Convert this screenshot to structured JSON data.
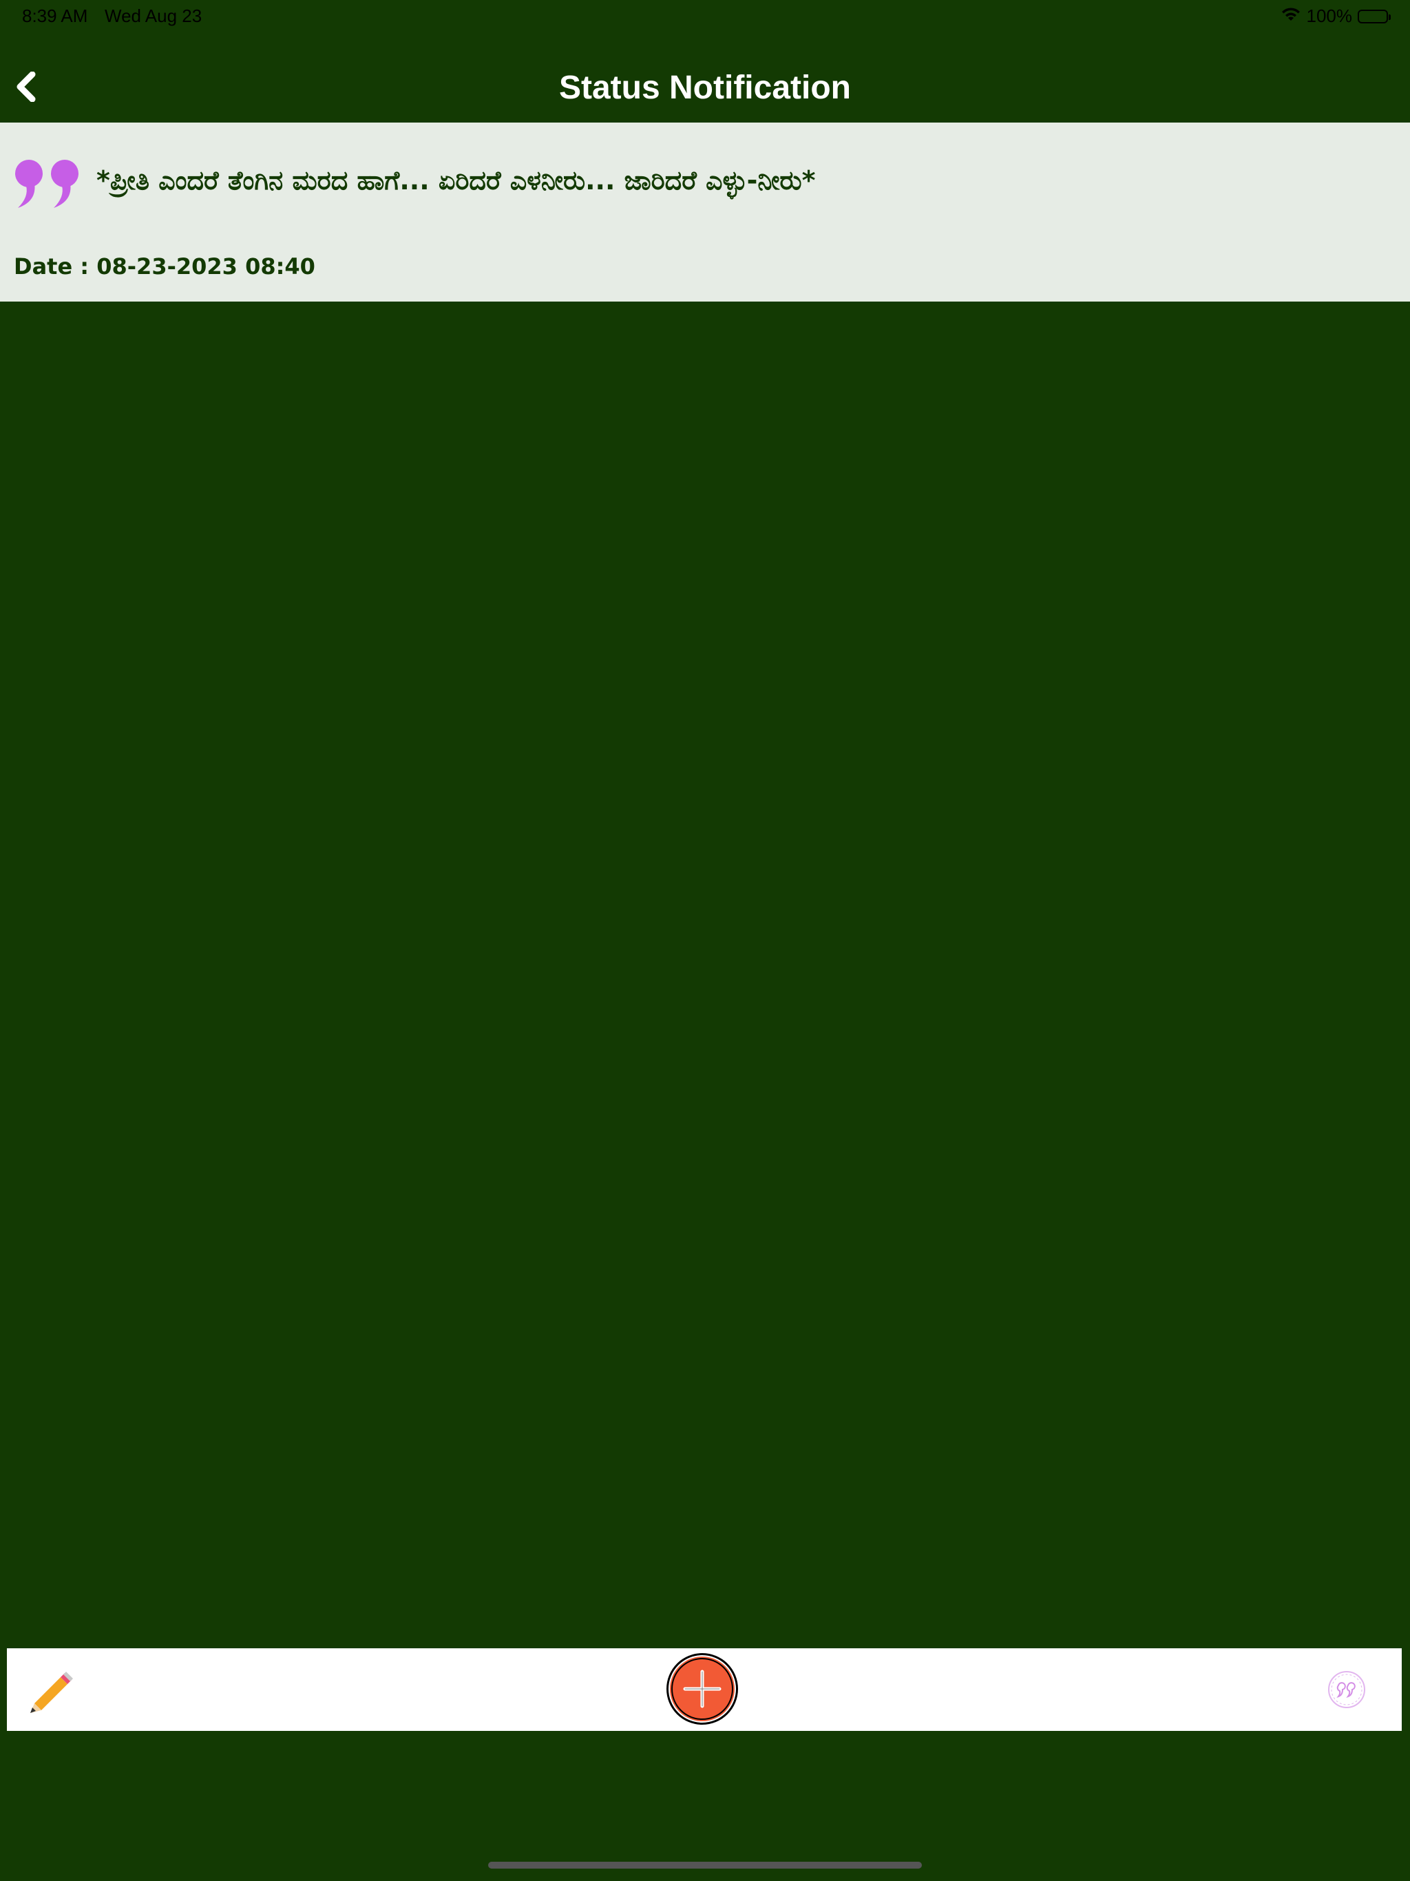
{
  "status_bar": {
    "time": "8:39 AM",
    "date": "Wed Aug 23",
    "battery": "100%"
  },
  "header": {
    "title": "Status Notification",
    "back_icon": "chevron-left-icon"
  },
  "notification": {
    "quote": "*ಪ್ರೀತಿ ಎಂದರೆ ತೆಂಗಿನ ಮರದ ಹಾಗೆ... ಏರಿದರೆ ಎಳನೀರು... ಜಾರಿದರೆ ಎಳ್ಳು-ನೀರು*",
    "date": "Date : 08-23-2023 08:40",
    "icon": "quote-icon"
  },
  "bottom_bar": {
    "left_icon": "pencil-icon",
    "center_icon": "plus-icon",
    "right_icon": "quotes-icon"
  },
  "colors": {
    "background": "#133a03",
    "card_background": "#e6ece5",
    "quote_icon": "#c65ee6",
    "add_button": "#f25a35",
    "pencil": "#f5a623"
  }
}
